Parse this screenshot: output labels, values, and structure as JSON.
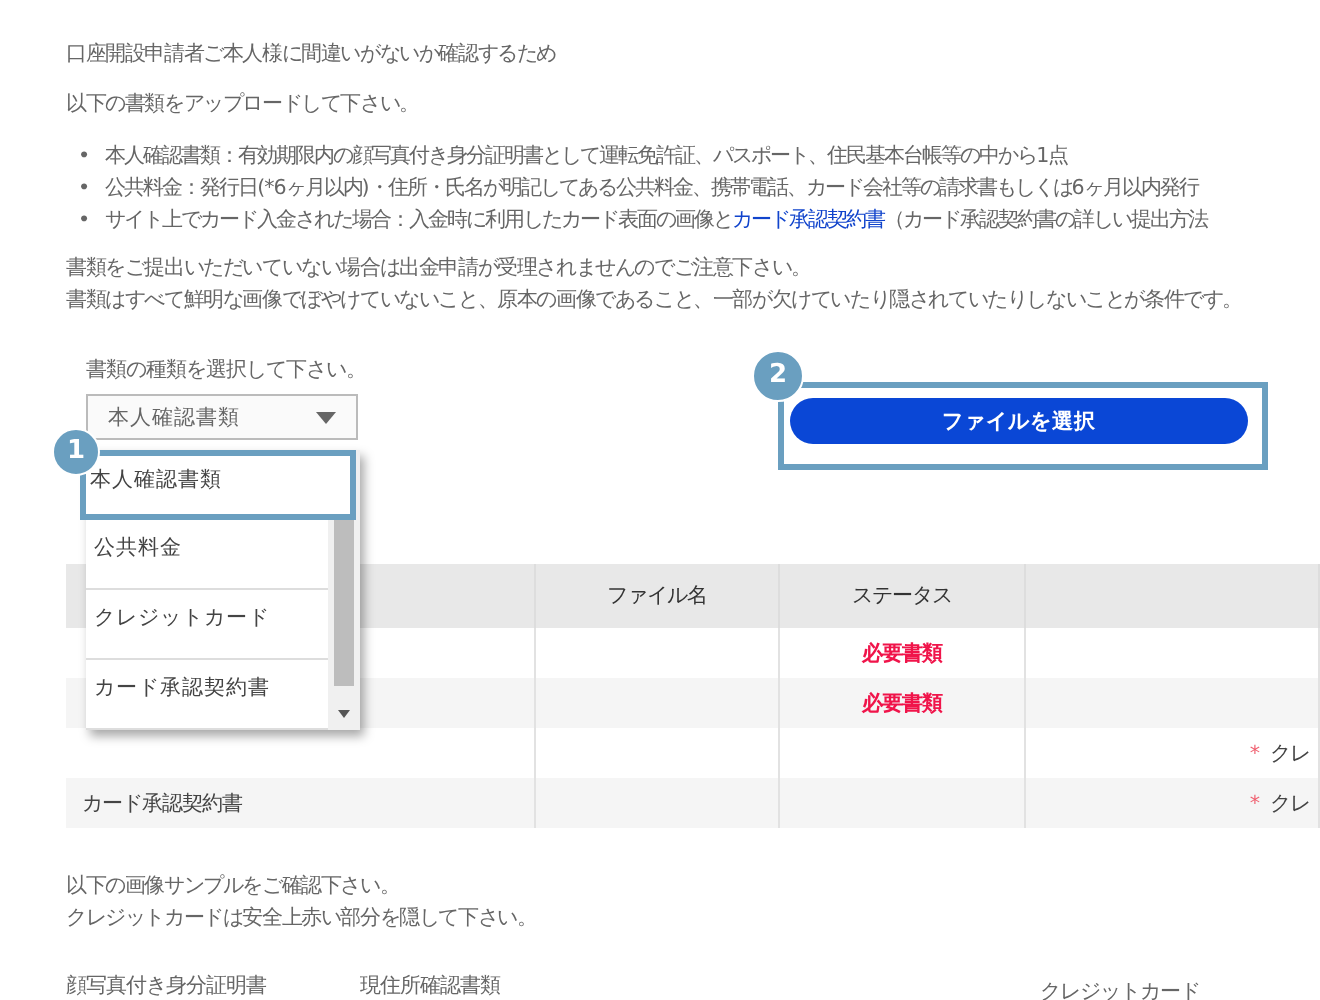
{
  "intro": "口座開設申請者ご本人様に間違いがないか確認するため",
  "instruction": "以下の書類をアップロードして下さい。",
  "requirements": [
    {
      "bullet": "•",
      "text": "本人確認書類：有効期限内の顔写真付き身分証明書として運転免許証、パスポート、住民基本台帳等の中から1点"
    },
    {
      "bullet": "•",
      "text": "公共料金：発行日(*6ヶ月以内)・住所・氏名が明記してある公共料金、携帯電話、カード会社等の請求書もしくは6ヶ月以内発行"
    },
    {
      "bullet": "•",
      "text": "サイト上でカード入金された場合：入金時に利用したカード表面の画像と",
      "link": "カード承認契約書",
      "after": "（カード承認契約書の詳しい提出方法"
    }
  ],
  "warnings": [
    "書類をご提出いただいていない場合は出金申請が受理されませんのでご注意下さい。",
    "書類はすべて鮮明な画像でぼやけていないこと、原本の画像であること、一部が欠けていたり隠されていたりしないことが条件です。"
  ],
  "selector": {
    "label": "書類の種類を選択して下さい。",
    "value": "本人確認書類",
    "step_badge": "1",
    "expanded": true,
    "options": [
      {
        "label": "本人確認書類",
        "selected": true
      },
      {
        "label": "公共料金",
        "selected": false
      },
      {
        "label": "クレジットカード",
        "selected": false
      },
      {
        "label": "カード承認契約書",
        "selected": false
      }
    ]
  },
  "upload": {
    "step_badge": "2",
    "button": "ファイルを選択"
  },
  "table": {
    "columns": [
      "ファイル名",
      "ステータス"
    ],
    "rows": [
      {
        "status": "必要書類"
      },
      {
        "status": "必要書類"
      },
      {
        "note_mark": "*",
        "note": "クレ"
      },
      {
        "document": "カード承認契約書",
        "note_mark": "*",
        "note": "クレ"
      }
    ]
  },
  "samples": {
    "lines": [
      "以下の画像サンプルをご確認下さい。",
      "クレジットカードは安全上赤い部分を隠して下さい。"
    ],
    "labels": [
      "顔写真付き身分証明書",
      "現住所確認書類",
      "クレジットカード"
    ]
  }
}
